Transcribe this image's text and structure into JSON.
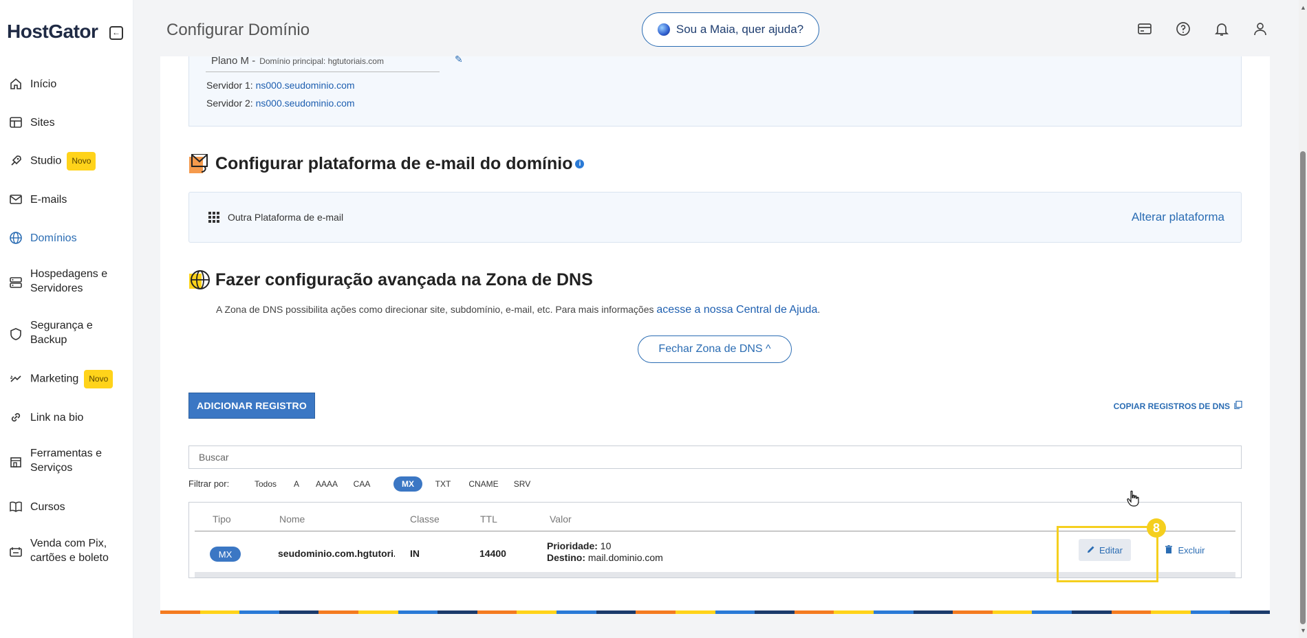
{
  "sidebar": {
    "logo": "HostGator",
    "collapse_glyph": "←",
    "items": [
      {
        "label": "Início",
        "icon": "home-icon"
      },
      {
        "label": "Sites",
        "icon": "layout-icon"
      },
      {
        "label": "Studio",
        "icon": "rocket-icon",
        "badge": "Novo"
      },
      {
        "label": "E-mails",
        "icon": "mail-icon"
      },
      {
        "label": "Domínios",
        "icon": "globe-icon",
        "active": true
      },
      {
        "label": "Hospedagens e Servidores",
        "line1": "Hospedagens e",
        "line2": "Servidores",
        "icon": "server-icon"
      },
      {
        "label": "Segurança e Backup",
        "line1": "Segurança e",
        "line2": "Backup",
        "icon": "shield-icon"
      },
      {
        "label": "Marketing",
        "icon": "sparkle-arrow-icon",
        "badge": "Novo"
      },
      {
        "label": "Link na bio",
        "icon": "link-icon"
      },
      {
        "label": "Ferramentas e Serviços",
        "line1": "Ferramentas e",
        "line2": "Serviços",
        "icon": "store-icon"
      },
      {
        "label": "Cursos",
        "icon": "book-icon"
      },
      {
        "label": "Venda com Pix, cartões e boleto",
        "line1": "Venda com Pix,",
        "line2": "cartões e boleto",
        "icon": "payment-icon"
      }
    ]
  },
  "header": {
    "title": "Configurar Domínio",
    "maia_label": "Sou a Maia, quer ajuda?"
  },
  "server_info": {
    "plan_label": "Plano M -",
    "plan_sub": "Domínio principal: hgtutoriais.com",
    "server1_label": "Servidor 1:",
    "server1_value": "ns000.seudominio.com",
    "server2_label": "Servidor 2:",
    "server2_value": "ns000.seudominio.com"
  },
  "email_section": {
    "title": "Configurar plataforma de e-mail do domínio",
    "info_glyph": "i",
    "platform_label": "Outra Plataforma de e-mail",
    "change_link": "Alterar plataforma"
  },
  "dns_section": {
    "title": "Fazer configuração avançada na Zona de DNS",
    "description": "A Zona de DNS possibilita ações como direcionar site, subdomínio, e-mail, etc. Para mais informações ",
    "help_link": "acesse a nossa Central de Ajuda",
    "help_suffix": ".",
    "close_button": "Fechar Zona de DNS ^",
    "add_button": "ADICIONAR REGISTRO",
    "copy_link": "COPIAR REGISTROS DE DNS",
    "search_placeholder": "Buscar",
    "filter_label": "Filtrar por:",
    "filters": [
      "Todos",
      "A",
      "AAAA",
      "CAA",
      "MX",
      "TXT",
      "CNAME",
      "SRV"
    ],
    "active_filter": "MX"
  },
  "table": {
    "headers": [
      "Tipo",
      "Nome",
      "Classe",
      "TTL",
      "Valor"
    ],
    "rows": [
      {
        "tipo": "MX",
        "nome": "seudominio.com.hgtutori...",
        "classe": "IN",
        "ttl": "14400",
        "prioridade_label": "Prioridade:",
        "prioridade": "10",
        "destino_label": "Destino:",
        "destino": "mail.dominio.com",
        "edit_label": "Editar",
        "delete_label": "Excluir"
      }
    ]
  },
  "annotation": {
    "step": "8",
    "color": "#f5cf1e"
  },
  "colors": {
    "accent": "#2a6cb3",
    "button_primary": "#3b77c4",
    "badge": "#ffd31a"
  }
}
